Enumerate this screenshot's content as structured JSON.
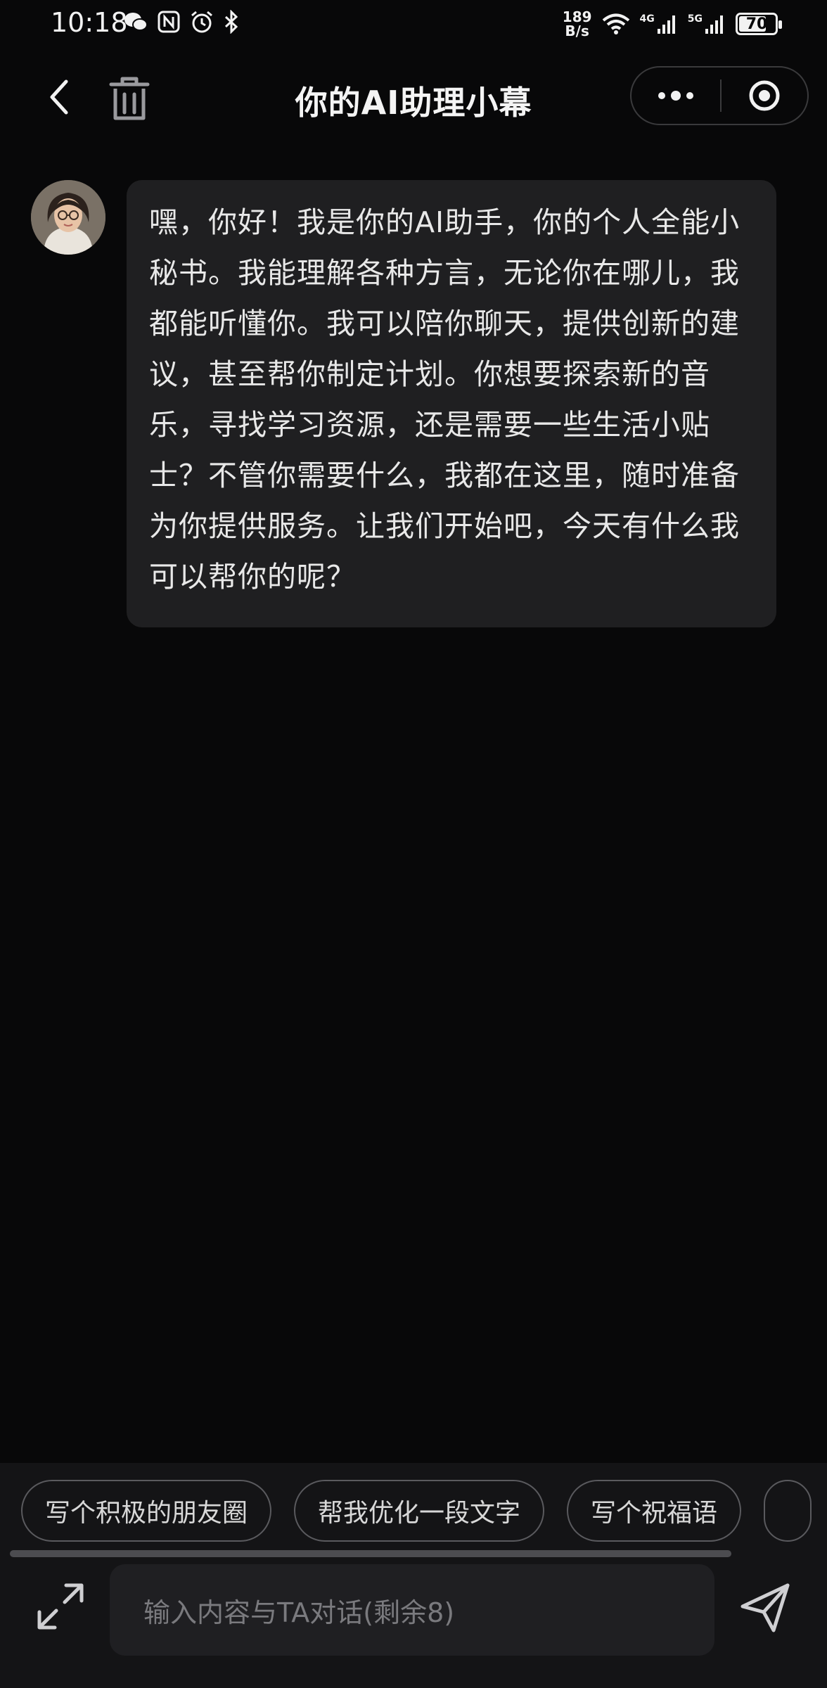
{
  "status_bar": {
    "time": "10:18",
    "speed_value": "189",
    "speed_unit": "B/s",
    "network_1": "4G",
    "network_2": "5G",
    "battery": "70",
    "left_icons": [
      "wechat-icon",
      "nfc-icon",
      "alarm-icon",
      "bluetooth-icon"
    ],
    "right_icons": [
      "wifi-icon",
      "signal-icon",
      "signal-icon"
    ]
  },
  "nav": {
    "title": "你的AI助理小幕",
    "icons": [
      "back-icon",
      "trash-icon",
      "more-icon",
      "close-miniprogram-icon"
    ]
  },
  "messages": [
    {
      "sender": "assistant",
      "text": "嘿，你好！我是你的AI助手，你的个人全能小秘书。我能理解各种方言，无论你在哪儿，我都能听懂你。我可以陪你聊天，提供创新的建议，甚至帮你制定计划。你想要探索新的音乐，寻找学习资源，还是需要一些生活小贴士？不管你需要什么，我都在这里，随时准备为你提供服务。让我们开始吧，今天有什么我可以帮你的呢？"
    }
  ],
  "suggestions": [
    {
      "label": "写个积极的朋友圈"
    },
    {
      "label": "帮我优化一段文字"
    },
    {
      "label": "写个祝福语"
    },
    {
      "label": ""
    }
  ],
  "input": {
    "placeholder": "输入内容与TA对话(剩余8)"
  },
  "colors": {
    "background": "#080809",
    "bubble": "#1f1f21",
    "bottom_panel": "#141416"
  }
}
